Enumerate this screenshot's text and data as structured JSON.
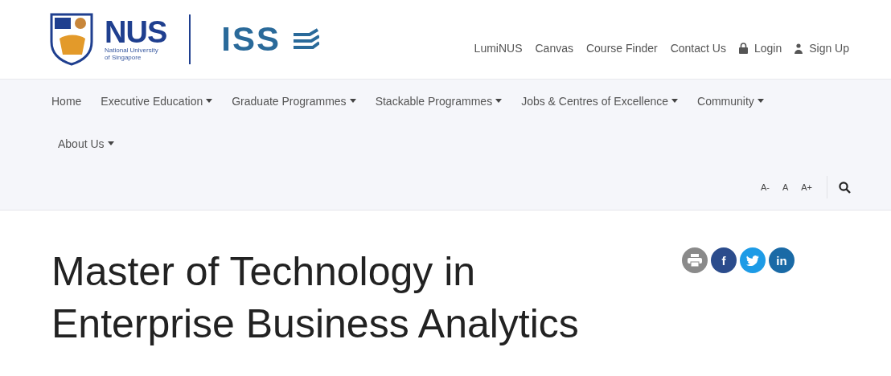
{
  "logo": {
    "nus": "NUS",
    "subtitle": [
      "National University",
      "of Singapore"
    ],
    "iss": "ISS"
  },
  "top_links": [
    {
      "label": "LumiNUS",
      "kind": "text"
    },
    {
      "label": "Canvas",
      "kind": "text"
    },
    {
      "label": "Course Finder",
      "kind": "text"
    },
    {
      "label": "Contact Us",
      "kind": "text"
    },
    {
      "label": "Login",
      "kind": "lock"
    },
    {
      "label": "Sign Up",
      "kind": "user"
    }
  ],
  "nav": [
    {
      "label": "Home",
      "dropdown": false
    },
    {
      "label": "Executive Education",
      "dropdown": true
    },
    {
      "label": "Graduate Programmes",
      "dropdown": true
    },
    {
      "label": "Stackable Programmes",
      "dropdown": true
    },
    {
      "label": "Jobs & Centres of Excellence",
      "dropdown": true
    },
    {
      "label": "Community",
      "dropdown": true
    },
    {
      "label": "About Us",
      "dropdown": true
    }
  ],
  "font_size_buttons": [
    "A-",
    "A",
    "A+"
  ],
  "title": [
    "Master of Technology in",
    "Enterprise Business Analytics"
  ],
  "share": [
    {
      "kind": "print"
    },
    {
      "kind": "facebook",
      "label": "f"
    },
    {
      "kind": "twitter"
    },
    {
      "kind": "linkedin",
      "label": "in"
    }
  ]
}
